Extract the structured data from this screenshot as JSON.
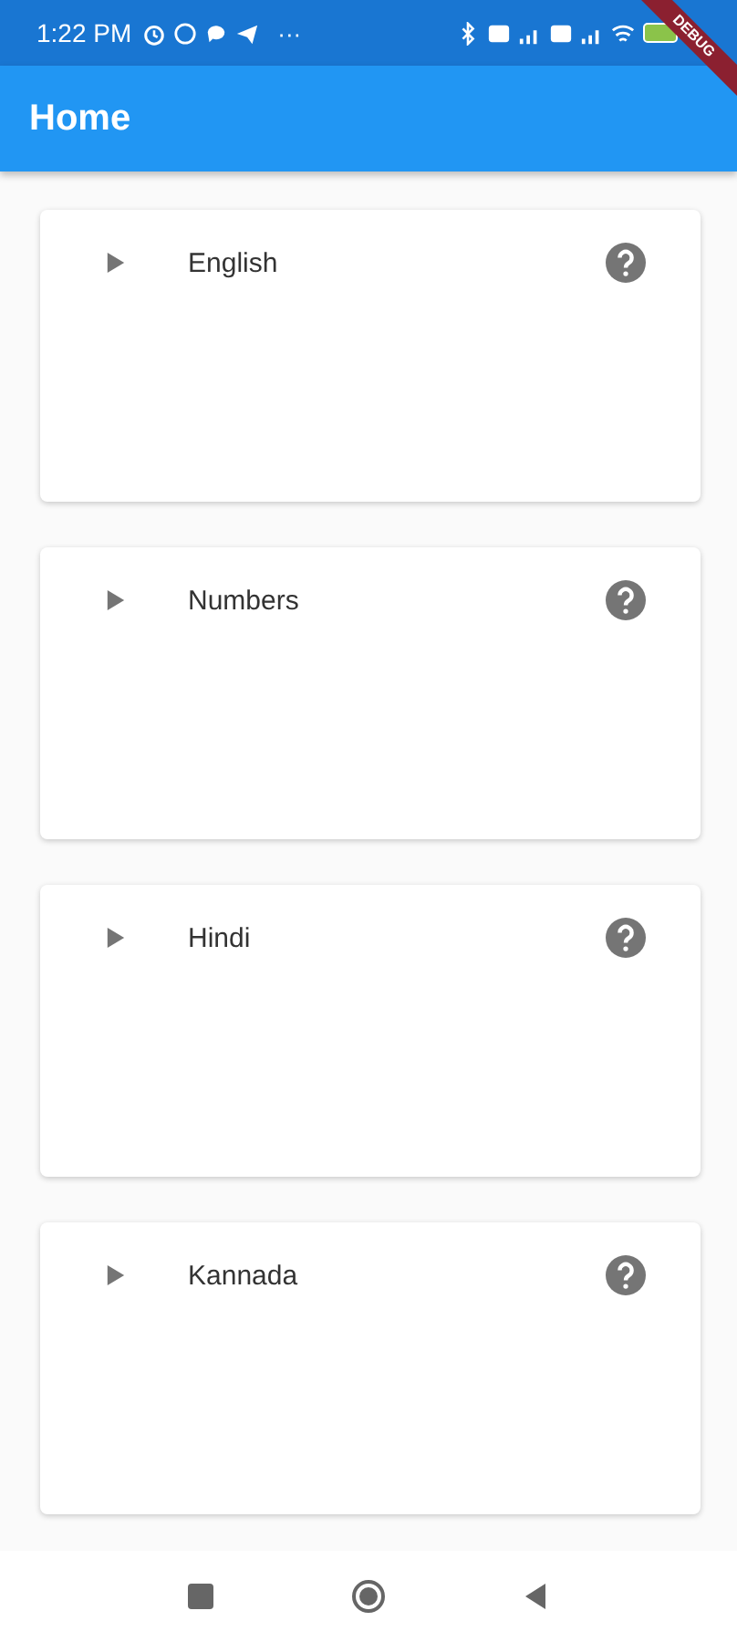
{
  "status_bar": {
    "time": "1:22 PM",
    "more": "···"
  },
  "debug_banner": {
    "label": "DEBUG"
  },
  "app_bar": {
    "title": "Home"
  },
  "cards": [
    {
      "title": "English"
    },
    {
      "title": "Numbers"
    },
    {
      "title": "Hindi"
    },
    {
      "title": "Kannada"
    }
  ]
}
